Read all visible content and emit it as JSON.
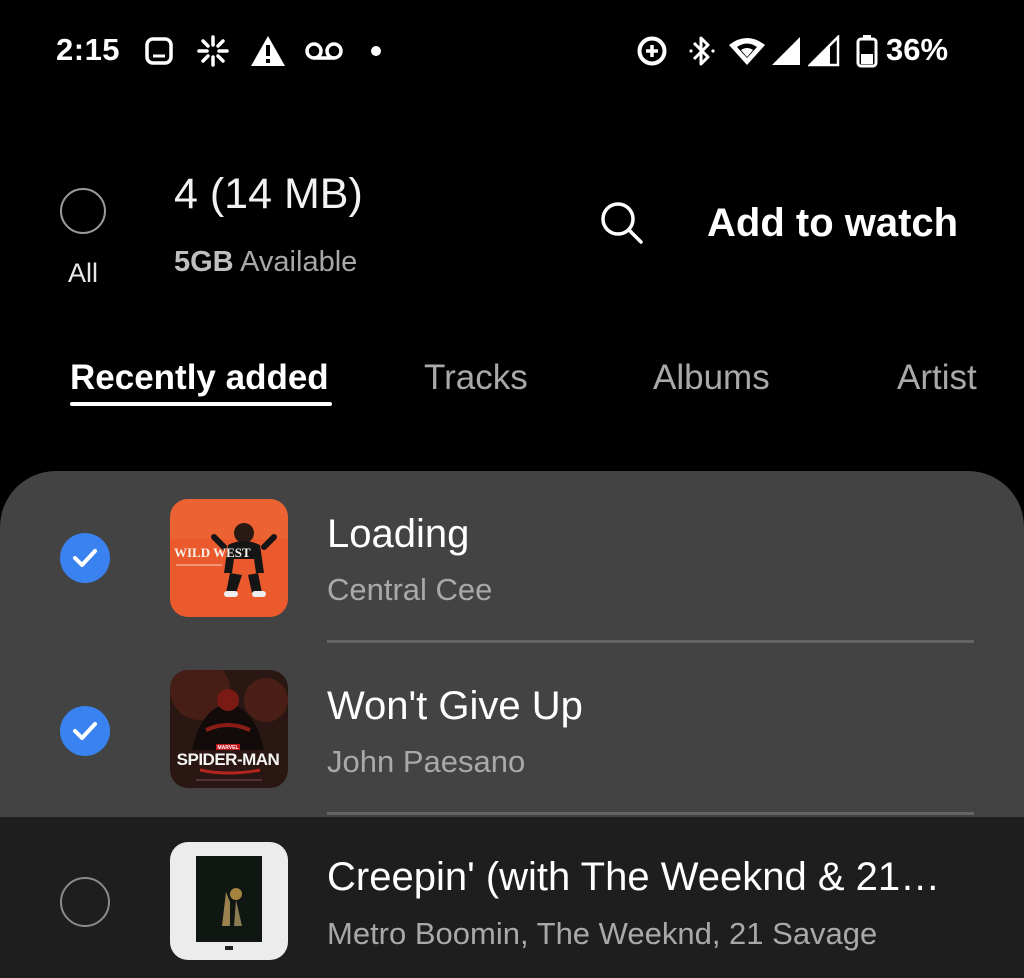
{
  "status_bar": {
    "time": "2:15",
    "battery_percent": "36%",
    "icons": [
      "message-icon",
      "network-activity-icon",
      "warning-icon",
      "voicemail-icon",
      "dot-icon",
      "data-saver-icon",
      "bluetooth-icon",
      "wifi-icon",
      "signal-icon",
      "signal-icon",
      "battery-icon"
    ]
  },
  "header": {
    "select_all_label": "All",
    "selection_count": "4 (14 MB)",
    "storage_amount": "5GB",
    "storage_label": "Available",
    "action_label": "Add to watch"
  },
  "tabs": [
    {
      "label": "Recently added",
      "active": true
    },
    {
      "label": "Tracks",
      "active": false
    },
    {
      "label": "Albums",
      "active": false
    },
    {
      "label": "Artist",
      "active": false
    }
  ],
  "tracks": [
    {
      "title": "Loading",
      "artist": "Central Cee",
      "selected": true,
      "art_text": "WILD WEST"
    },
    {
      "title": "Won't Give Up",
      "artist": "John Paesano",
      "selected": true,
      "art_text": "SPIDER-MAN",
      "art_brand": "MARVEL"
    },
    {
      "title": "Creepin' (with The Weeknd & 21…",
      "artist": "Metro Boomin, The Weeknd, 21 Savage",
      "selected": false
    }
  ],
  "colors": {
    "accent": "#3b82f1",
    "background": "#000000",
    "sheet": "#434343"
  }
}
